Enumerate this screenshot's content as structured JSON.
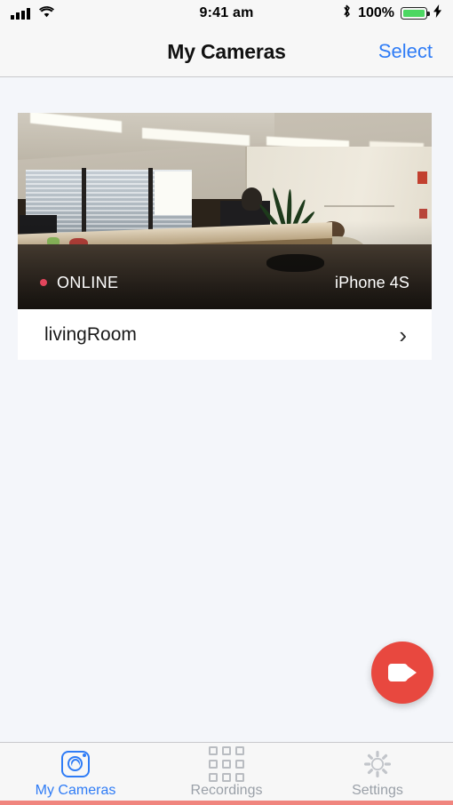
{
  "status_bar": {
    "time": "9:41 am",
    "battery_percent": "100%",
    "icons": [
      "signal-bars-icon",
      "wifi-icon",
      "bluetooth-icon",
      "battery-icon",
      "charging-bolt-icon"
    ],
    "battery_color": "#4cd762"
  },
  "nav_bar": {
    "title": "My Cameras",
    "action_label": "Select",
    "action_color": "#2f7cf6"
  },
  "cameras": [
    {
      "name": "livingRoom",
      "status": "ONLINE",
      "status_color": "#e2455c",
      "device": "iPhone 4S",
      "chevron": "›",
      "thumbnail": "office-room-live-preview"
    }
  ],
  "fab": {
    "name": "add-camera-button",
    "icon": "video-camera-icon",
    "color": "#e8483f"
  },
  "tab_bar": {
    "active_index": 0,
    "active_color": "#2f7cf6",
    "inactive_color": "#9aa0a8",
    "tabs": [
      {
        "label": "My Cameras",
        "icon": "camera-icon"
      },
      {
        "label": "Recordings",
        "icon": "grid-icon"
      },
      {
        "label": "Settings",
        "icon": "gear-icon"
      }
    ]
  },
  "theme": {
    "background": "#f4f6fa",
    "bar_background": "#f7f7f7",
    "card_background": "#ffffff",
    "home_indicator_color": "#f0857e"
  }
}
